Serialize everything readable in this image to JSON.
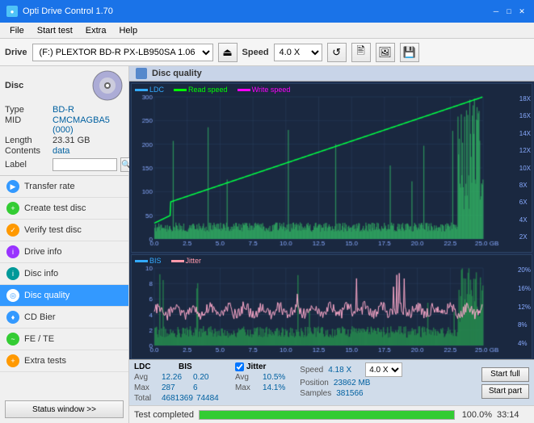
{
  "titlebar": {
    "title": "Opti Drive Control 1.70",
    "icon": "●",
    "min": "─",
    "max": "□",
    "close": "✕"
  },
  "menubar": {
    "items": [
      "File",
      "Start test",
      "Extra",
      "Help"
    ]
  },
  "toolbar": {
    "drive_label": "Drive",
    "drive_value": "(F:) PLEXTOR BD-R  PX-LB950SA 1.06",
    "speed_label": "Speed",
    "speed_value": "4.0 X"
  },
  "disc": {
    "type_label": "Type",
    "type_value": "BD-R",
    "mid_label": "MID",
    "mid_value": "CMCMAGBA5 (000)",
    "length_label": "Length",
    "length_value": "23.31 GB",
    "contents_label": "Contents",
    "contents_value": "data",
    "label_label": "Label"
  },
  "nav": {
    "items": [
      {
        "id": "transfer-rate",
        "label": "Transfer rate",
        "icon": "▶",
        "color": "blue",
        "active": false
      },
      {
        "id": "create-test-disc",
        "label": "Create test disc",
        "icon": "+",
        "color": "green",
        "active": false
      },
      {
        "id": "verify-test-disc",
        "label": "Verify test disc",
        "icon": "✓",
        "color": "orange",
        "active": false
      },
      {
        "id": "drive-info",
        "label": "Drive info",
        "icon": "i",
        "color": "purple",
        "active": false
      },
      {
        "id": "disc-info",
        "label": "Disc info",
        "icon": "i",
        "color": "teal",
        "active": false
      },
      {
        "id": "disc-quality",
        "label": "Disc quality",
        "icon": "◎",
        "color": "cyan",
        "active": true
      },
      {
        "id": "cd-bier",
        "label": "CD Bier",
        "icon": "♦",
        "color": "blue",
        "active": false
      },
      {
        "id": "fe-te",
        "label": "FE / TE",
        "icon": "~",
        "color": "green",
        "active": false
      },
      {
        "id": "extra-tests",
        "label": "Extra tests",
        "icon": "+",
        "color": "orange",
        "active": false
      }
    ],
    "status_btn": "Status window >>"
  },
  "disc_quality": {
    "title": "Disc quality",
    "legend": {
      "ldc": "LDC",
      "read_speed": "Read speed",
      "write_speed": "Write speed",
      "bis": "BIS",
      "jitter": "Jitter"
    }
  },
  "chart1": {
    "y_left_max": 300,
    "y_right_labels": [
      "18X",
      "16X",
      "14X",
      "12X",
      "10X",
      "8X",
      "6X",
      "4X",
      "2X"
    ],
    "x_labels": [
      "0.0",
      "2.5",
      "5.0",
      "7.5",
      "10.0",
      "12.5",
      "15.0",
      "17.5",
      "20.0",
      "22.5",
      "25.0 GB"
    ]
  },
  "chart2": {
    "y_left_max": 10,
    "y_right_labels": [
      "20%",
      "16%",
      "12%",
      "8%",
      "4%"
    ],
    "x_labels": [
      "0.0",
      "2.5",
      "5.0",
      "7.5",
      "10.0",
      "12.5",
      "15.0",
      "17.5",
      "20.0",
      "22.5",
      "25.0 GB"
    ]
  },
  "stats": {
    "headers": [
      "LDC",
      "BIS",
      "",
      "Jitter",
      "Speed",
      ""
    ],
    "avg_label": "Avg",
    "avg_ldc": "12.26",
    "avg_bis": "0.20",
    "avg_jitter": "10.5%",
    "max_label": "Max",
    "max_ldc": "287",
    "max_bis": "6",
    "max_jitter": "14.1%",
    "total_label": "Total",
    "total_ldc": "4681369",
    "total_bis": "74484",
    "jitter_checked": true,
    "speed_label": "Speed",
    "speed_val": "4.18 X",
    "speed_select": "4.0 X",
    "position_label": "Position",
    "position_val": "23862 MB",
    "samples_label": "Samples",
    "samples_val": "381566",
    "start_full": "Start full",
    "start_part": "Start part"
  },
  "progress": {
    "label": "Test completed",
    "percent": 100.0,
    "percent_display": "100.0%",
    "time": "33:14"
  }
}
